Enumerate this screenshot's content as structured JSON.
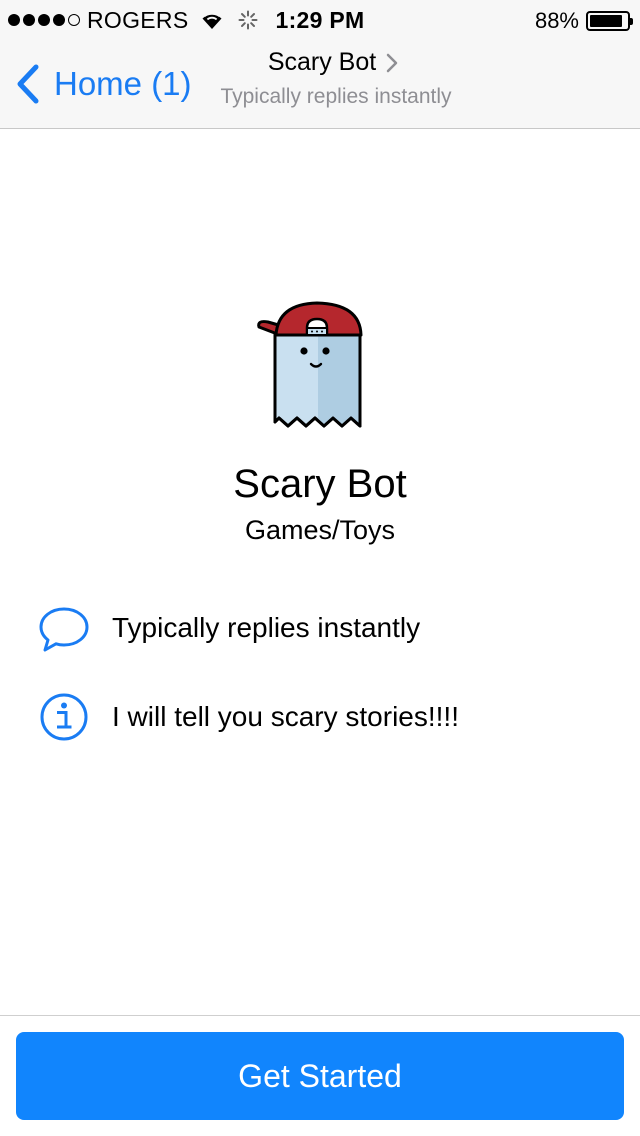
{
  "status_bar": {
    "carrier": "ROGERS",
    "signal_bars_filled": 4,
    "signal_bars_total": 5,
    "time": "1:29 PM",
    "battery_percent": "88%",
    "battery_level": 0.88
  },
  "nav": {
    "back_label": "Home (1)",
    "title": "Scary Bot",
    "subtitle": "Typically replies instantly",
    "back_icon": "chevron-left-icon",
    "title_icon": "chevron-right-icon"
  },
  "profile": {
    "name": "Scary Bot",
    "category": "Games/Toys",
    "avatar_icon": "ghost-with-cap-icon"
  },
  "info_rows": [
    {
      "icon": "chat-bubble-icon",
      "text": "Typically replies instantly"
    },
    {
      "icon": "info-icon",
      "text": "I will tell you scary stories!!!!"
    }
  ],
  "footer": {
    "button_label": "Get Started"
  },
  "colors": {
    "accent": "#1a7cf3",
    "button": "#1185fd",
    "bar_background": "#f7f7f7",
    "subtitle_gray": "#8e8e93",
    "cap_red": "#b5272d",
    "ghost_blue": "#c9e0f0"
  }
}
